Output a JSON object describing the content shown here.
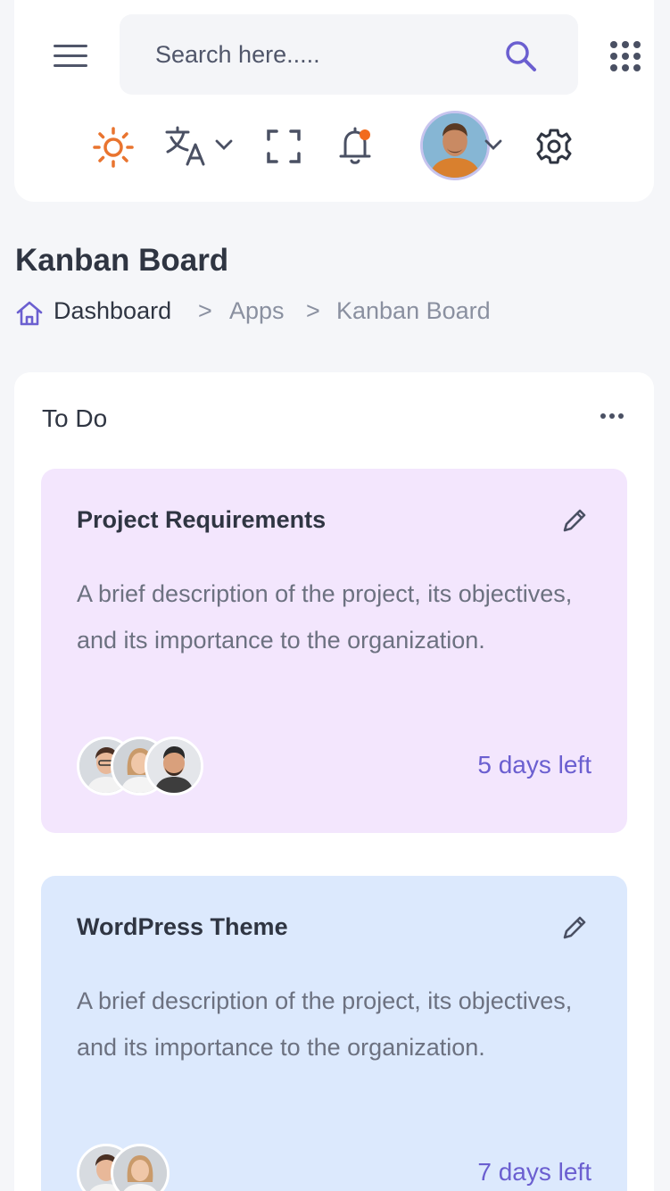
{
  "search": {
    "placeholder": "Search here....."
  },
  "page": {
    "title": "Kanban Board",
    "breadcrumb": {
      "home": "Dashboard",
      "sep": ">",
      "apps": "Apps",
      "current": "Kanban Board"
    }
  },
  "column": {
    "title": "To Do",
    "cards": [
      {
        "title": "Project Requirements",
        "description": "A brief description of the project, its objectives, and its importance to the organization.",
        "days_left": "5 days left",
        "background": "#f3e6fd"
      },
      {
        "title": "WordPress Theme",
        "description": "A brief description of the project, its objectives, and its importance to the organization.",
        "days_left": "7 days left",
        "background": "#dce9fd"
      }
    ]
  },
  "icons": {
    "menu": "hamburger-icon",
    "search": "search-icon",
    "apps": "grid-icon",
    "theme": "sun-icon",
    "language": "translate-icon",
    "fullscreen": "fullscreen-icon",
    "notifications": "bell-icon",
    "settings": "gear-icon",
    "edit": "pencil-icon",
    "more": "more-horizontal-icon",
    "home": "home-icon"
  },
  "colors": {
    "accent": "#6b5fd0",
    "sun": "#e9742f",
    "notification_dot": "#f26b1d",
    "card_purple": "#f3e6fd",
    "card_blue": "#dce9fd"
  }
}
